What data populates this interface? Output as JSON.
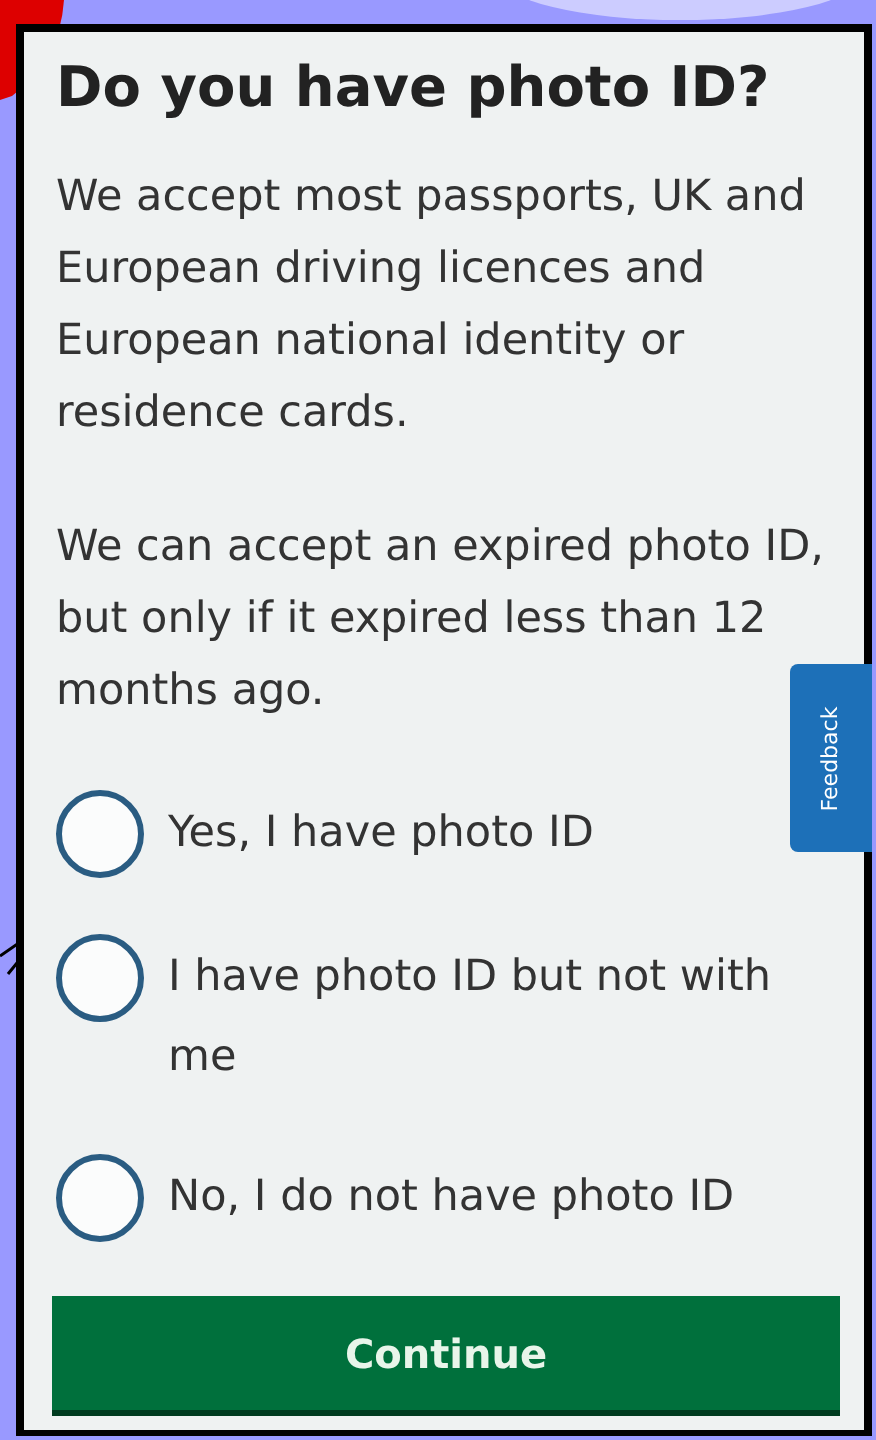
{
  "heading": "Do you have photo ID?",
  "paragraphs": [
    "We accept most passports, UK and European driving licences and European national identity or residence cards.",
    "We can accept an expired photo ID, but only if it expired less than 12 months ago."
  ],
  "options": [
    {
      "label": "Yes, I have photo ID",
      "selected": false
    },
    {
      "label": "I have photo ID but not with me",
      "selected": false
    },
    {
      "label": "No, I do not have photo ID",
      "selected": false
    }
  ],
  "feedback_tab": "Feedback",
  "button": "Continue"
}
